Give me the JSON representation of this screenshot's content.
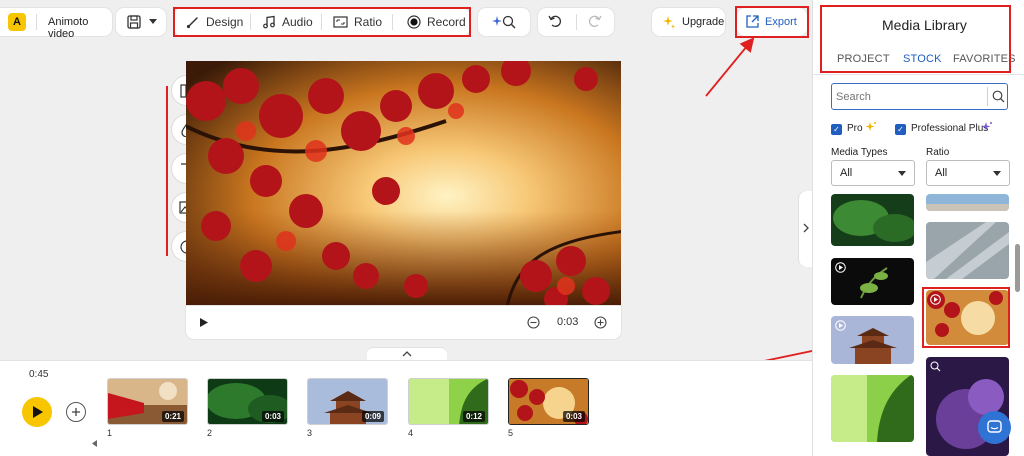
{
  "header": {
    "project_name": "Animoto video",
    "tools": {
      "design_label": "Design",
      "audio_label": "Audio",
      "ratio_label": "Ratio",
      "record_label": "Record"
    },
    "upgrade_label": "Upgrade",
    "export_label": "Export"
  },
  "player": {
    "time": "0:03"
  },
  "timeline": {
    "total_duration": "0:45",
    "clips": [
      {
        "number": "1",
        "duration": "0:21"
      },
      {
        "number": "2",
        "duration": "0:03"
      },
      {
        "number": "3",
        "duration": "0:09"
      },
      {
        "number": "4",
        "duration": "0:12"
      },
      {
        "number": "5",
        "duration": "0:03"
      }
    ]
  },
  "library": {
    "title": "Media Library",
    "tabs": {
      "project": "PROJECT",
      "stock": "STOCK",
      "favorites": "FAVORITES"
    },
    "search_placeholder": "Search",
    "filters": {
      "pro_label": "Pro",
      "pro_plus_label": "Professional Plus"
    },
    "media_types": {
      "label": "Media Types",
      "value": "All"
    },
    "ratio": {
      "label": "Ratio",
      "value": "All"
    }
  },
  "colors": {
    "accent_yellow": "#f7c600",
    "link_blue": "#1f5fbf",
    "annotation_red": "#e02020"
  }
}
